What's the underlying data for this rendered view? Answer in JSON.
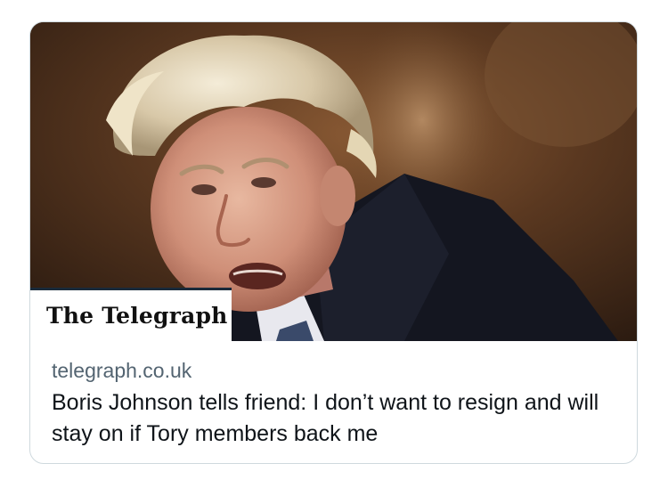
{
  "card": {
    "media_alt": "Photo of a man with messy blond hair in a dark suit",
    "brand": "The Telegraph",
    "domain": "telegraph.co.uk",
    "headline": "Boris Johnson tells friend: I don’t want to resign and will stay on if Tory members back me"
  },
  "colors": {
    "card_border": "#cfd9de",
    "domain_text": "#536471",
    "headline_text": "#0f1419",
    "brand_rule": "#1a2a3a"
  }
}
